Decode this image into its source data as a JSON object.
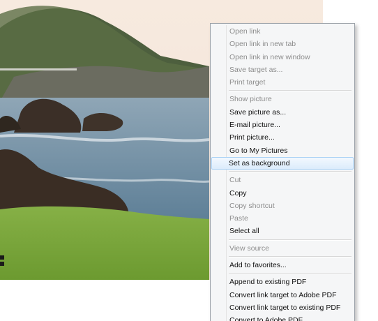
{
  "background": {
    "description_icon": "landscape-photo",
    "sky_color": "#f6e8dc",
    "sea_color": "#6c8aa0",
    "grass_color": "#78a43a"
  },
  "context_menu": {
    "items": [
      {
        "label": "Open link",
        "enabled": false
      },
      {
        "label": "Open link in new tab",
        "enabled": false
      },
      {
        "label": "Open link in new window",
        "enabled": false
      },
      {
        "label": "Save target as...",
        "enabled": false
      },
      {
        "label": "Print target",
        "enabled": false
      },
      {
        "separator": true
      },
      {
        "label": "Show picture",
        "enabled": false
      },
      {
        "label": "Save picture as...",
        "enabled": true
      },
      {
        "label": "E-mail picture...",
        "enabled": true
      },
      {
        "label": "Print picture...",
        "enabled": true
      },
      {
        "label": "Go to My Pictures",
        "enabled": true
      },
      {
        "label": "Set as background",
        "enabled": true,
        "highlighted": true
      },
      {
        "separator": true
      },
      {
        "label": "Cut",
        "enabled": false
      },
      {
        "label": "Copy",
        "enabled": true
      },
      {
        "label": "Copy shortcut",
        "enabled": false
      },
      {
        "label": "Paste",
        "enabled": false
      },
      {
        "label": "Select all",
        "enabled": true
      },
      {
        "separator": true
      },
      {
        "label": "View source",
        "enabled": false
      },
      {
        "separator": true
      },
      {
        "label": "Add to favorites...",
        "enabled": true
      },
      {
        "separator": true
      },
      {
        "label": "Append to existing PDF",
        "enabled": true
      },
      {
        "label": "Convert link target to Adobe PDF",
        "enabled": true
      },
      {
        "label": "Convert link target to existing PDF",
        "enabled": true
      },
      {
        "label": "Convert to Adobe PDF",
        "enabled": true
      }
    ]
  }
}
